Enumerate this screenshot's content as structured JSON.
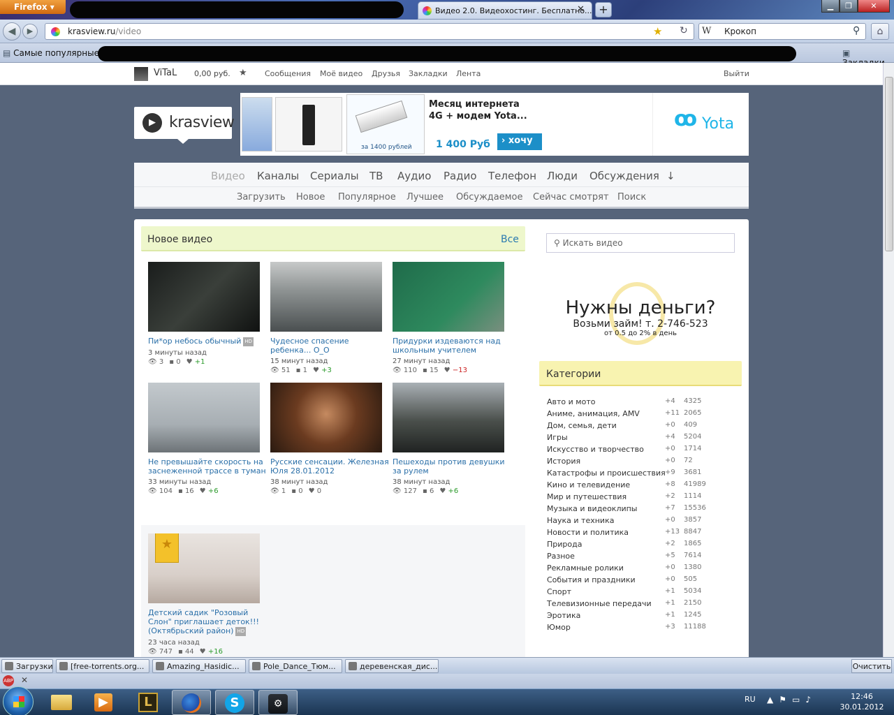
{
  "browser": {
    "menu_label": "Firefox",
    "active_tab_title": "Видео 2.0. Видеохостинг. Бесплатно...",
    "url_domain": "krasview.ru",
    "url_path": "/video",
    "search_engine_icon": "W",
    "search_text": "Крокоп",
    "bookmarks_popular": "Самые популярные",
    "bookmarks_menu": "Закладки"
  },
  "userbar": {
    "username": "ViTaL",
    "balance": "0,00 руб.",
    "links": [
      "Сообщения",
      "Моё видео",
      "Друзья",
      "Закладки",
      "Лента"
    ],
    "logout": "Выйти"
  },
  "logo": {
    "text": "krasview"
  },
  "banner": {
    "small_price": "за 1400 рублей",
    "title_line1": "Месяц интернета",
    "title_line2": "4G + модем Yota...",
    "price": "1 400 Руб",
    "button": "› хочу",
    "brand": "Yota"
  },
  "nav": {
    "main": [
      "Видео",
      "Каналы",
      "Сериалы",
      "ТВ",
      "Аудио",
      "Радио",
      "Телефон",
      "Люди",
      "Обсуждения",
      "↓"
    ],
    "sub": [
      "Загрузить",
      "Новое",
      "Популярное",
      "Лучшее",
      "Обсуждаемое",
      "Сейчас смотрят",
      "Поиск"
    ]
  },
  "new_videos": {
    "title": "Новое видео",
    "all_link": "Все",
    "items": [
      {
        "title": "Пи*ор небось обычный",
        "hd": "HD",
        "time": "3 минуты назад",
        "views": "3",
        "comments": "0",
        "rating": "+1"
      },
      {
        "title": "Чудесное спасение ребенка... О_О",
        "hd": "",
        "time": "15 минут назад",
        "views": "51",
        "comments": "1",
        "rating": "+3"
      },
      {
        "title": "Придурки издеваются над школьным учителем",
        "hd": "",
        "time": "27 минут назад",
        "views": "110",
        "comments": "15",
        "rating": "−13"
      },
      {
        "title": "Не превышайте скорость на заснеженной трассе в туман",
        "hd": "",
        "time": "33 минуты назад",
        "views": "104",
        "comments": "16",
        "rating": "+6"
      },
      {
        "title": "Русские сенсации. Железная Юля 28.01.2012",
        "hd": "",
        "time": "38 минут назад",
        "views": "1",
        "comments": "0",
        "rating": "0"
      },
      {
        "title": "Пешеходы против девушки за рулем",
        "hd": "",
        "time": "38 минут назад",
        "views": "127",
        "comments": "6",
        "rating": "+6"
      },
      {
        "title": "Детский садик \"Розовый Слон\" приглашает деток!!! (Октябрьский район)",
        "hd": "HD",
        "time": "23 часа назад",
        "views": "747",
        "comments": "44",
        "rating": "+16"
      }
    ]
  },
  "sidebar": {
    "search_placeholder": "Искать видео",
    "ad_title": "Нужны деньги?",
    "ad_line2": "Возьми займ! т. 2-746-523",
    "ad_line3": "от 0.5 до 2% в день",
    "categories_title": "Категории",
    "categories": [
      {
        "name": "Авто и мото",
        "delta": "+4",
        "count": "4325"
      },
      {
        "name": "Аниме, анимация, AMV",
        "delta": "+11",
        "count": "2065"
      },
      {
        "name": "Дом, семья, дети",
        "delta": "+0",
        "count": "409"
      },
      {
        "name": "Игры",
        "delta": "+4",
        "count": "5204"
      },
      {
        "name": "Искусство и творчество",
        "delta": "+0",
        "count": "1714"
      },
      {
        "name": "История",
        "delta": "+0",
        "count": "72"
      },
      {
        "name": "Катастрофы и происшествия",
        "delta": "+9",
        "count": "3681"
      },
      {
        "name": "Кино и телевидение",
        "delta": "+8",
        "count": "41989"
      },
      {
        "name": "Мир и путешествия",
        "delta": "+2",
        "count": "1114"
      },
      {
        "name": "Музыка и видеоклипы",
        "delta": "+7",
        "count": "15536"
      },
      {
        "name": "Наука и техника",
        "delta": "+0",
        "count": "3857"
      },
      {
        "name": "Новости и политика",
        "delta": "+13",
        "count": "8847"
      },
      {
        "name": "Природа",
        "delta": "+2",
        "count": "1865"
      },
      {
        "name": "Разное",
        "delta": "+5",
        "count": "7614"
      },
      {
        "name": "Рекламные ролики",
        "delta": "+0",
        "count": "1380"
      },
      {
        "name": "События и праздники",
        "delta": "+0",
        "count": "505"
      },
      {
        "name": "Спорт",
        "delta": "+1",
        "count": "5034"
      },
      {
        "name": "Телевизионные передачи",
        "delta": "+1",
        "count": "2150"
      },
      {
        "name": "Эротика",
        "delta": "+1",
        "count": "1245"
      },
      {
        "name": "Юмор",
        "delta": "+3",
        "count": "11188"
      }
    ]
  },
  "downloads": {
    "items": [
      "Загрузки",
      "[free-torrents.org...",
      "Amazing_Hasidic...",
      "Pole_Dance_Тюм...",
      "деревенская_дис..."
    ],
    "clear": "Очистить"
  },
  "statusbar": {
    "abp": "ABP",
    "close": "✕"
  },
  "taskbar": {
    "lang": "RU",
    "time": "12:46",
    "date": "30.01.2012",
    "apps": [
      "folder-icon",
      "media-player-icon",
      "lol-icon",
      "firefox-icon",
      "skype-icon",
      "steam-icon"
    ]
  }
}
